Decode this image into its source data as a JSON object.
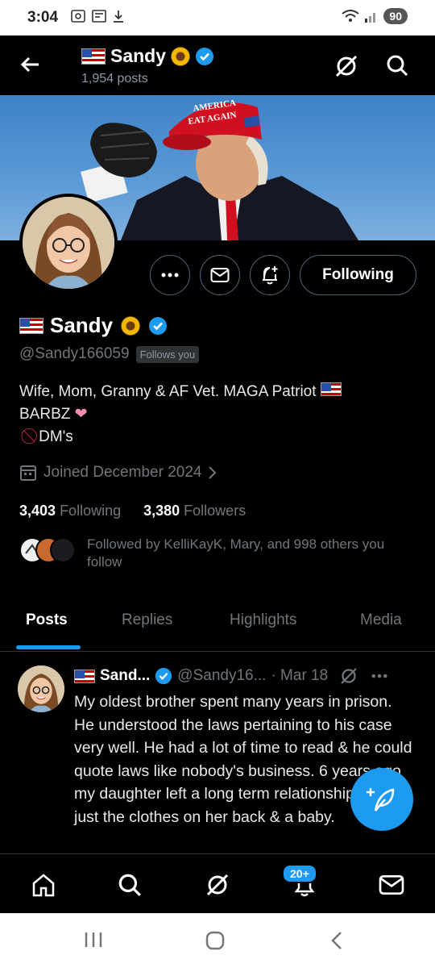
{
  "status_bar": {
    "time": "3:04",
    "battery": "90"
  },
  "header": {
    "name": "Sandy",
    "posts": "1,954 posts"
  },
  "profile": {
    "name": "Sandy",
    "handle": "@Sandy166059",
    "follows_you": "Follows you",
    "bio_line1": "Wife, Mom, Granny & AF Vet. MAGA Patriot",
    "bio_line2": "BARBZ",
    "bio_line3": "DM's",
    "joined": "Joined December 2024",
    "following_count": "3,403",
    "following_label": "Following",
    "followers_count": "3,380",
    "followers_label": "Followers",
    "followed_by": "Followed by KelliKayK, Mary, and 998 others you follow"
  },
  "banner": {
    "hat_text_line1": "AMERICA",
    "hat_text_line2": "EAT AGAIN"
  },
  "actions": {
    "follow_label": "Following"
  },
  "tabs": [
    {
      "label": "Posts",
      "active": true
    },
    {
      "label": "Replies",
      "active": false
    },
    {
      "label": "Highlights",
      "active": false
    },
    {
      "label": "Media",
      "active": false
    }
  ],
  "tweet": {
    "name": "Sand...",
    "handle": "@Sandy16...",
    "date": "· Mar 18",
    "text": "My oldest brother spent many years in prison.  He understood the laws pertaining to his case very well.  He had a lot of time to read & he could quote laws like nobody's business.  6 years ago my daughter left a long term relationship with just the clothes on her back & a baby."
  },
  "bottom_nav": {
    "notifications_badge": "20+"
  },
  "colors": {
    "accent": "#1d9bf0",
    "background": "#000000",
    "muted": "#71767b"
  }
}
